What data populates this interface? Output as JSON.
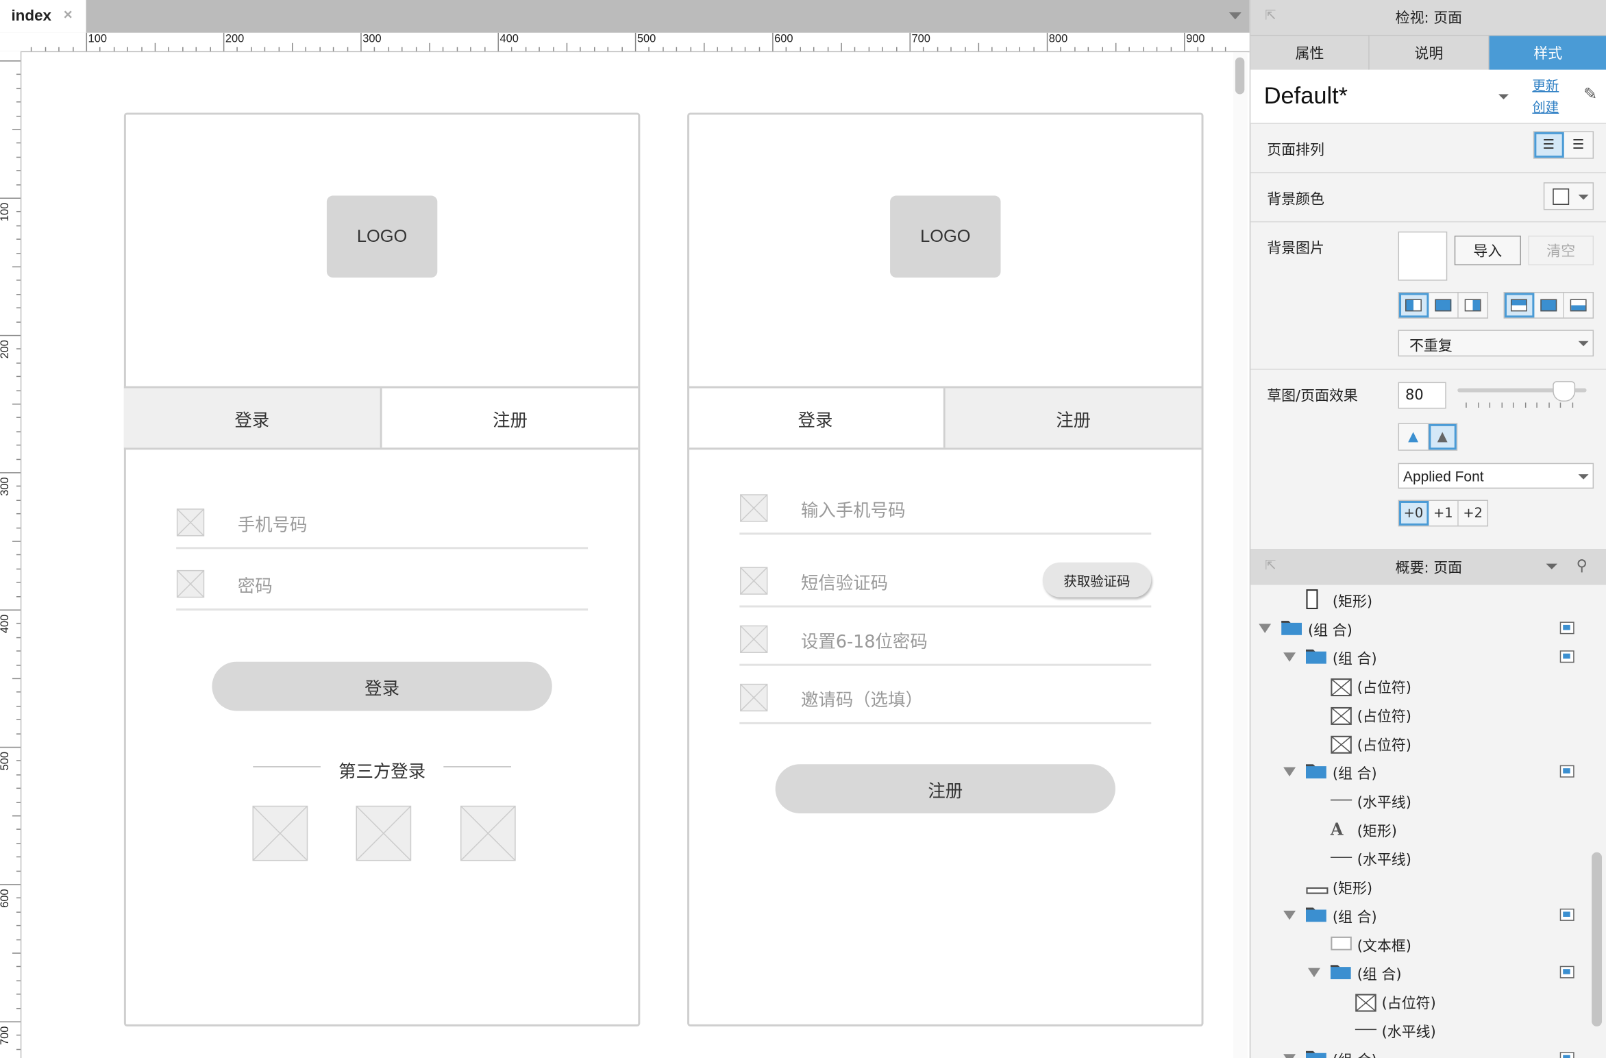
{
  "tab": {
    "title": "index",
    "close": "×"
  },
  "ruler": {
    "h": [
      "100",
      "200",
      "300",
      "400",
      "500",
      "600",
      "700",
      "800",
      "900"
    ],
    "v": [
      "100",
      "200",
      "300",
      "400",
      "500",
      "600",
      "700"
    ]
  },
  "login": {
    "logo": "LOGO",
    "tab_login": "登录",
    "tab_register": "注册",
    "phone": "手机号码",
    "password": "密码",
    "login_button": "登录",
    "third_party": "第三方登录"
  },
  "register": {
    "logo": "LOGO",
    "tab_login": "登录",
    "tab_register": "注册",
    "phone": "输入手机号码",
    "sms": "短信验证码",
    "get_code": "获取验证码",
    "password": "设置6-18位密码",
    "invite": "邀请码（选填）",
    "register_button": "注册"
  },
  "inspector": {
    "title": "检视: 页面",
    "tabs": [
      "属性",
      "说明",
      "样式"
    ],
    "active_tab": "样式",
    "style_name": "Default*",
    "update": "更新",
    "create": "创建",
    "page_align": "页面排列",
    "bg_color": "背景颜色",
    "bg_image": "背景图片",
    "import": "导入",
    "clear": "清空",
    "repeat": "不重复",
    "sketch_effect": "草图/页面效果",
    "sketch_value": "80",
    "sketch_fraction": 0.8,
    "font": "Applied Font",
    "font_sizes": [
      "+0",
      "+1",
      "+2"
    ]
  },
  "outline": {
    "title": "概要: 页面",
    "items": [
      {
        "depth": 1,
        "icon": "rect-tall",
        "label": "(矩形)"
      },
      {
        "depth": 0,
        "icon": "folder",
        "label": "(组 合)",
        "toggle": true,
        "badge": true
      },
      {
        "depth": 1,
        "icon": "folder",
        "label": "(组 合)",
        "toggle": true,
        "badge": true
      },
      {
        "depth": 2,
        "icon": "placeholder",
        "label": "(占位符)"
      },
      {
        "depth": 2,
        "icon": "placeholder",
        "label": "(占位符)"
      },
      {
        "depth": 2,
        "icon": "placeholder",
        "label": "(占位符)"
      },
      {
        "depth": 1,
        "icon": "folder",
        "label": "(组 合)",
        "toggle": true,
        "badge": true
      },
      {
        "depth": 2,
        "icon": "hline",
        "label": "(水平线)"
      },
      {
        "depth": 2,
        "icon": "text",
        "label": "(矩形)"
      },
      {
        "depth": 2,
        "icon": "hline",
        "label": "(水平线)"
      },
      {
        "depth": 1,
        "icon": "rect-wide",
        "label": "(矩形)"
      },
      {
        "depth": 1,
        "icon": "folder",
        "label": "(组 合)",
        "toggle": true,
        "badge": true
      },
      {
        "depth": 2,
        "icon": "textbox",
        "label": "(文本框)"
      },
      {
        "depth": 2,
        "icon": "folder",
        "label": "(组 合)",
        "toggle": true,
        "badge": true
      },
      {
        "depth": 3,
        "icon": "placeholder",
        "label": "(占位符)"
      },
      {
        "depth": 3,
        "icon": "hline",
        "label": "(水平线)"
      },
      {
        "depth": 1,
        "icon": "folder",
        "label": "(组 合)",
        "toggle": true,
        "badge": true
      }
    ]
  },
  "colors": {
    "accent": "#4a9bd6",
    "placeholder_gray": "#d6d6d6"
  }
}
